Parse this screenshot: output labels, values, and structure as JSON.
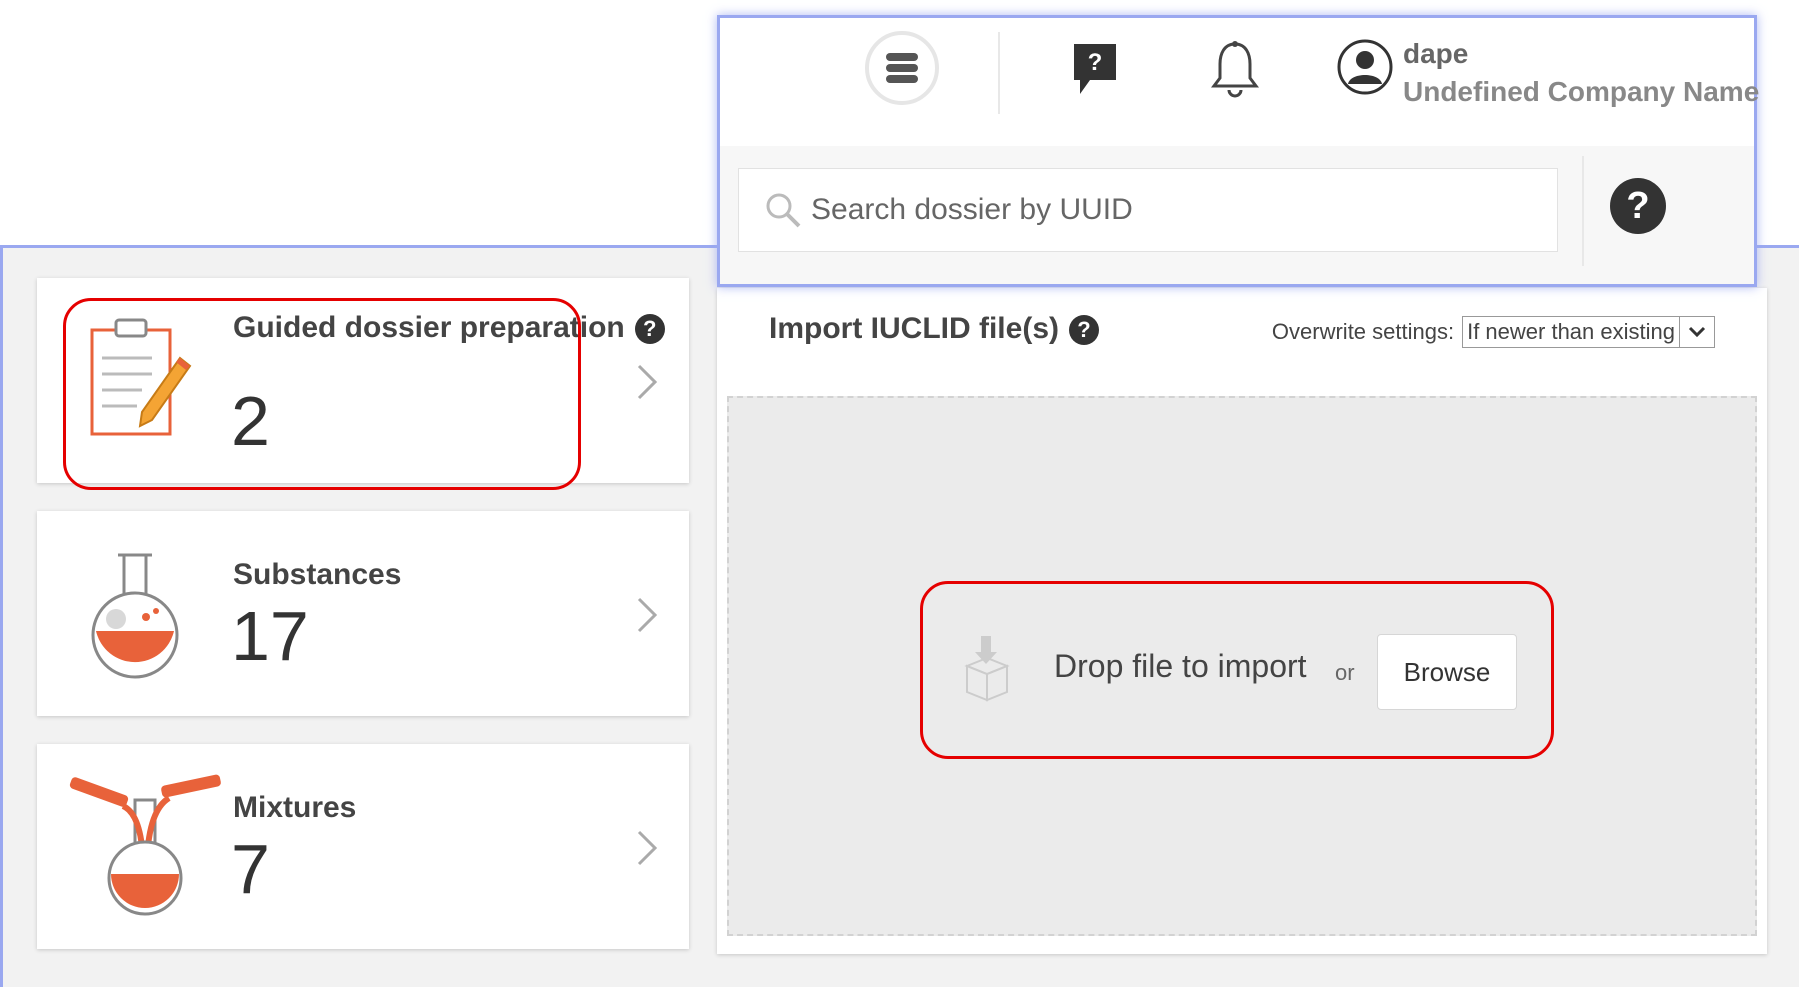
{
  "header": {
    "username": "dape",
    "company": "Undefined Company Name",
    "search_placeholder": "Search dossier by UUID",
    "help_glyph": "?",
    "icons": [
      "dossier-menu-icon",
      "help-chat-icon",
      "bell-icon",
      "user-avatar-icon",
      "search-icon",
      "help-icon"
    ]
  },
  "cards": [
    {
      "title": "Guided dossier preparation",
      "count": "2",
      "icon": "clipboard-pencil-icon",
      "help_glyph": "?"
    },
    {
      "title": "Substances",
      "count": "17",
      "icon": "flask-icon"
    },
    {
      "title": "Mixtures",
      "count": "7",
      "icon": "mixing-flasks-icon"
    }
  ],
  "import": {
    "title": "Import IUCLID file(s)",
    "help_glyph": "?",
    "overwrite_label": "Overwrite settings:",
    "overwrite_value": "If newer than existing",
    "drop_text": "Drop file to import",
    "or_text": "or",
    "browse_label": "Browse",
    "drop_icon": "box-drop-icon"
  },
  "colors": {
    "accent_orange": "#e8623a",
    "highlight_red": "#e50000",
    "frame_blue": "#9aa8f0"
  }
}
